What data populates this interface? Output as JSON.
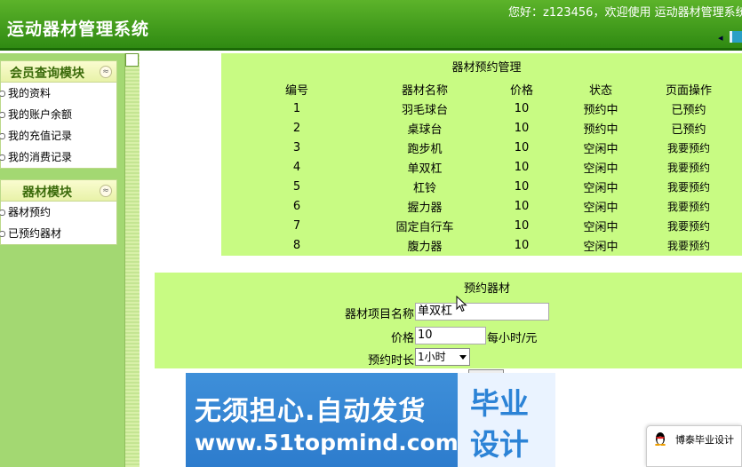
{
  "header": {
    "title": "运动器材管理系统",
    "welcome": "您好：z123456，欢迎使用 运动器材管理系统"
  },
  "sidebar": {
    "panels": [
      {
        "title": "会员查询模块",
        "items": [
          "我的资料",
          "我的账户余额",
          "我的充值记录",
          "我的消费记录"
        ]
      },
      {
        "title": "器材模块",
        "items": [
          "器材预约",
          "已预约器材"
        ]
      }
    ],
    "toggle": "≈"
  },
  "table": {
    "caption": "器材预约管理",
    "headers": [
      "编号",
      "器材名称",
      "价格",
      "状态",
      "页面操作"
    ],
    "rows": [
      [
        "1",
        "羽毛球台",
        "10",
        "预约中",
        "已预约"
      ],
      [
        "2",
        "桌球台",
        "10",
        "预约中",
        "已预约"
      ],
      [
        "3",
        "跑步机",
        "10",
        "空闲中",
        "我要预约"
      ],
      [
        "4",
        "单双杠",
        "10",
        "空闲中",
        "我要预约"
      ],
      [
        "5",
        "杠铃",
        "10",
        "空闲中",
        "我要预约"
      ],
      [
        "6",
        "握力器",
        "10",
        "空闲中",
        "我要预约"
      ],
      [
        "7",
        "固定自行车",
        "10",
        "空闲中",
        "我要预约"
      ],
      [
        "8",
        "腹力器",
        "10",
        "空闲中",
        "我要预约"
      ]
    ]
  },
  "form": {
    "caption": "预约器材",
    "name_label": "器材项目名称",
    "name_value": "单双杠",
    "price_label": "价格",
    "price_value": "10",
    "price_unit": "每小时/元",
    "duration_label": "预约时长",
    "duration_value": "1小时"
  },
  "ad": {
    "line1": "无须担心.自动发货",
    "line2": "www.51topmind.com",
    "stamp_top": "毕业",
    "stamp_bottom": "设计"
  },
  "qq_popup": {
    "text": "博泰毕业设计"
  },
  "colors": {
    "header": "#3f9a1a",
    "content_box": "#c8fb83",
    "sidebar": "#a3d872"
  }
}
